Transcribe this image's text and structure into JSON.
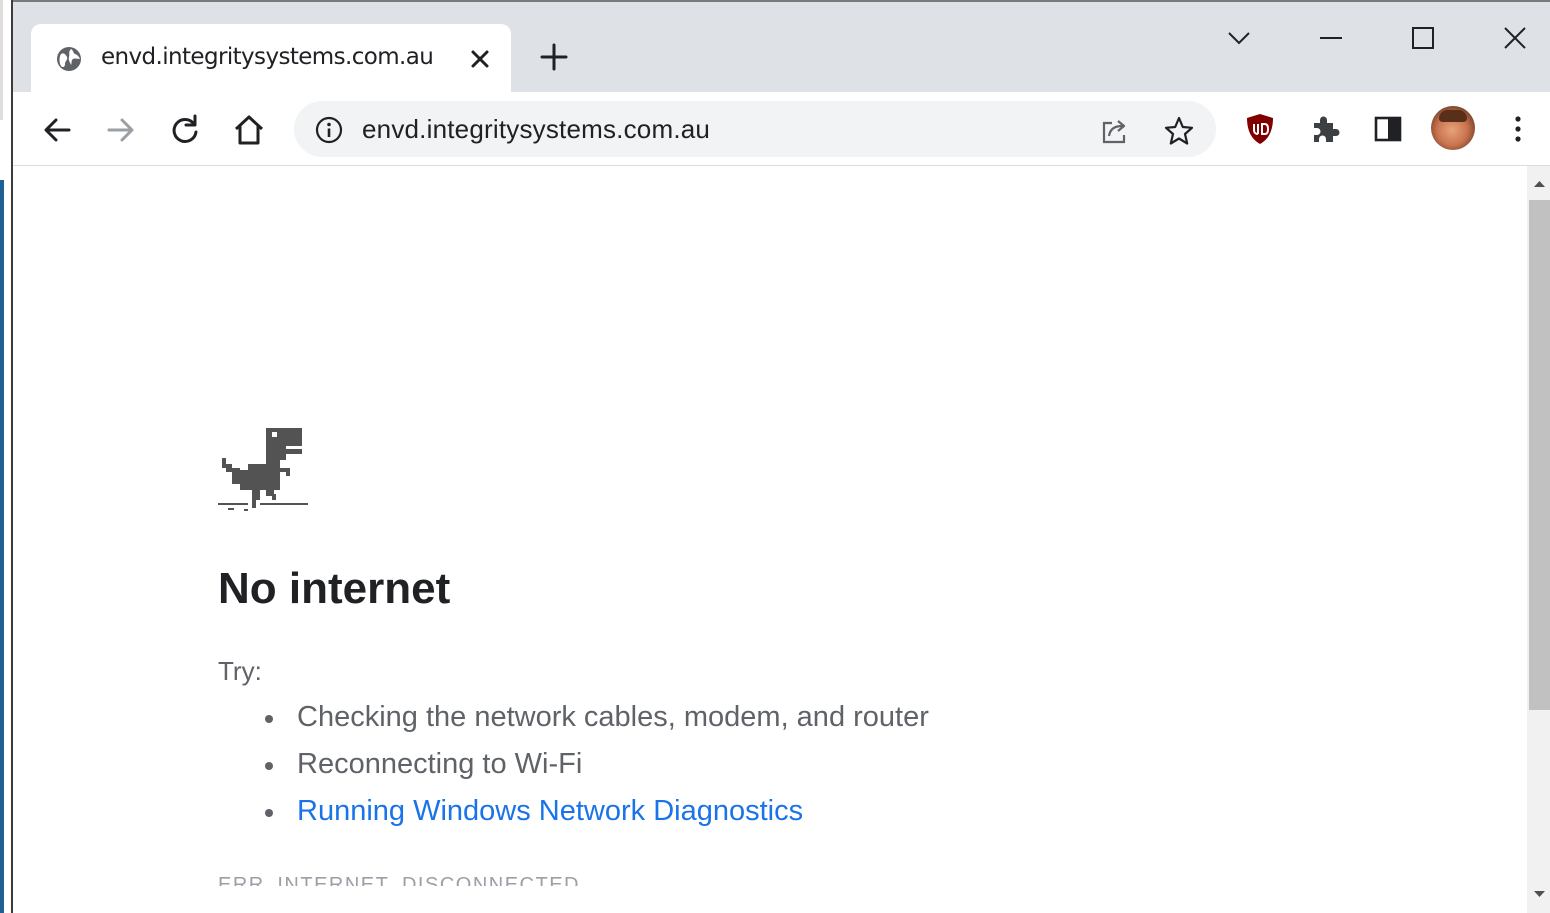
{
  "tab": {
    "title": "envd.integritysystems.com.au"
  },
  "omnibox": {
    "url": "envd.integritysystems.com.au"
  },
  "error": {
    "heading": "No internet",
    "try_label": "Try:",
    "suggestions": [
      "Checking the network cables, modem, and router",
      "Reconnecting to Wi-Fi",
      "Running Windows Network Diagnostics"
    ],
    "code": "ERR_INTERNET_DISCONNECTED"
  },
  "colors": {
    "titlebar": "#dee1e6",
    "link": "#1a73e8",
    "text_secondary": "#5f6368",
    "ublock_red": "#800000"
  }
}
